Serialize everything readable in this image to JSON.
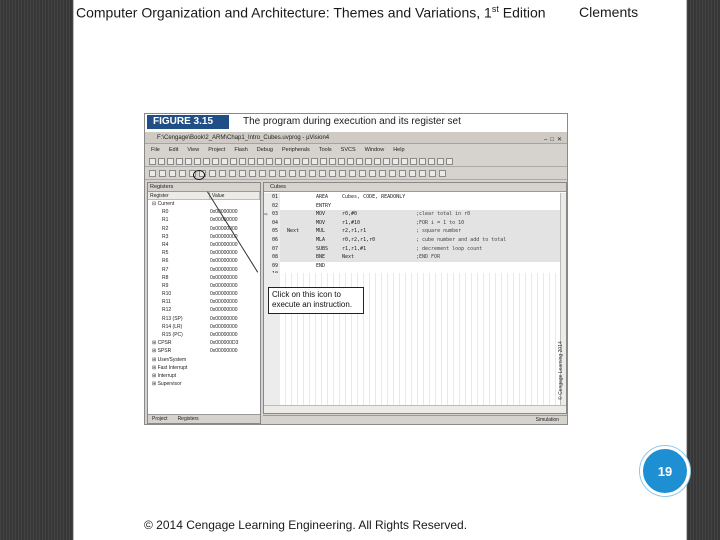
{
  "slide": {
    "header_title_main": "Computer Organization and Architecture: Themes and Variations, 1",
    "header_title_sup": "st",
    "header_title_tail": " Edition",
    "header_author": "Clements",
    "page_number": "19",
    "copyright": "© 2014 Cengage Learning Engineering. All Rights Reserved.",
    "colors": {
      "badge": "#1f8fd3",
      "figure_label_bg": "#1f4f86"
    }
  },
  "figure": {
    "label": "FIGURE 3.15",
    "title": "The program during execution and its register set",
    "ide": {
      "window_title": "F:\\Cengage\\Book\\2_ARM\\Chap1_Intro_Cubes.uvprog - µVision4",
      "menu": [
        "File",
        "Edit",
        "View",
        "Project",
        "Flash",
        "Debug",
        "Peripherals",
        "Tools",
        "SVCS",
        "Window",
        "Help"
      ],
      "registers_panel": {
        "title": "Registers",
        "col_register": "Register",
        "col_value": "Value",
        "rows": [
          {
            "name": "⊟ Current",
            "value": ""
          },
          {
            "name": "R0",
            "value": "0x00000000"
          },
          {
            "name": "R1",
            "value": "0x00000000"
          },
          {
            "name": "R2",
            "value": "0x00000000"
          },
          {
            "name": "R3",
            "value": "0x00000000"
          },
          {
            "name": "R4",
            "value": "0x00000000"
          },
          {
            "name": "R5",
            "value": "0x00000000"
          },
          {
            "name": "R6",
            "value": "0x00000000"
          },
          {
            "name": "R7",
            "value": "0x00000000"
          },
          {
            "name": "R8",
            "value": "0x00000000"
          },
          {
            "name": "R9",
            "value": "0x00000000"
          },
          {
            "name": "R10",
            "value": "0x00000000"
          },
          {
            "name": "R11",
            "value": "0x00000000"
          },
          {
            "name": "R12",
            "value": "0x00000000"
          },
          {
            "name": "R13 (SP)",
            "value": "0x00000000"
          },
          {
            "name": "R14 (LR)",
            "value": "0x00000000"
          },
          {
            "name": "R15 (PC)",
            "value": "0x00000000"
          },
          {
            "name": "⊞ CPSR",
            "value": "0x000000D3"
          },
          {
            "name": "⊞ SPSR",
            "value": "0x00000000"
          },
          {
            "name": "⊞ User/System",
            "value": ""
          },
          {
            "name": "⊞ Fast Interrupt",
            "value": ""
          },
          {
            "name": "⊞ Interrupt",
            "value": ""
          },
          {
            "name": "⊞ Supervisor",
            "value": ""
          }
        ],
        "tab_project": "Project",
        "tab_registers": "Registers"
      },
      "code_panel": {
        "tab": "Cubes",
        "lines": [
          {
            "ln": "01",
            "label": "",
            "op": "AREA",
            "args": "Cubes, CODE, READONLY",
            "comment": ""
          },
          {
            "ln": "02",
            "label": "",
            "op": "ENTRY",
            "args": "",
            "comment": ""
          },
          {
            "ln": "03",
            "label": "",
            "op": "MOV",
            "args": "r0,#0",
            "comment": ";clear total in r0"
          },
          {
            "ln": "04",
            "label": "",
            "op": "MOV",
            "args": "r1,#10",
            "comment": ";FOR i = 1 to 10"
          },
          {
            "ln": "05",
            "label": "Next",
            "op": "MUL",
            "args": "r2,r1,r1",
            "comment": "; square number"
          },
          {
            "ln": "06",
            "label": "",
            "op": "MLA",
            "args": "r0,r2,r1,r0",
            "comment": "; cube number and add to total"
          },
          {
            "ln": "07",
            "label": "",
            "op": "SUBS",
            "args": "r1,r1,#1",
            "comment": "; decrement loop count"
          },
          {
            "ln": "08",
            "label": "",
            "op": "BNE",
            "args": "Next",
            "comment": ";END FOR"
          },
          {
            "ln": "09",
            "label": "",
            "op": "END",
            "args": "",
            "comment": ""
          },
          {
            "ln": "10",
            "label": "",
            "op": "",
            "args": "",
            "comment": ""
          }
        ]
      },
      "callout": "Click on this icon to execute an instruction.",
      "status": "Simulation",
      "side_credit": "© Cengage Learning 2014"
    }
  }
}
